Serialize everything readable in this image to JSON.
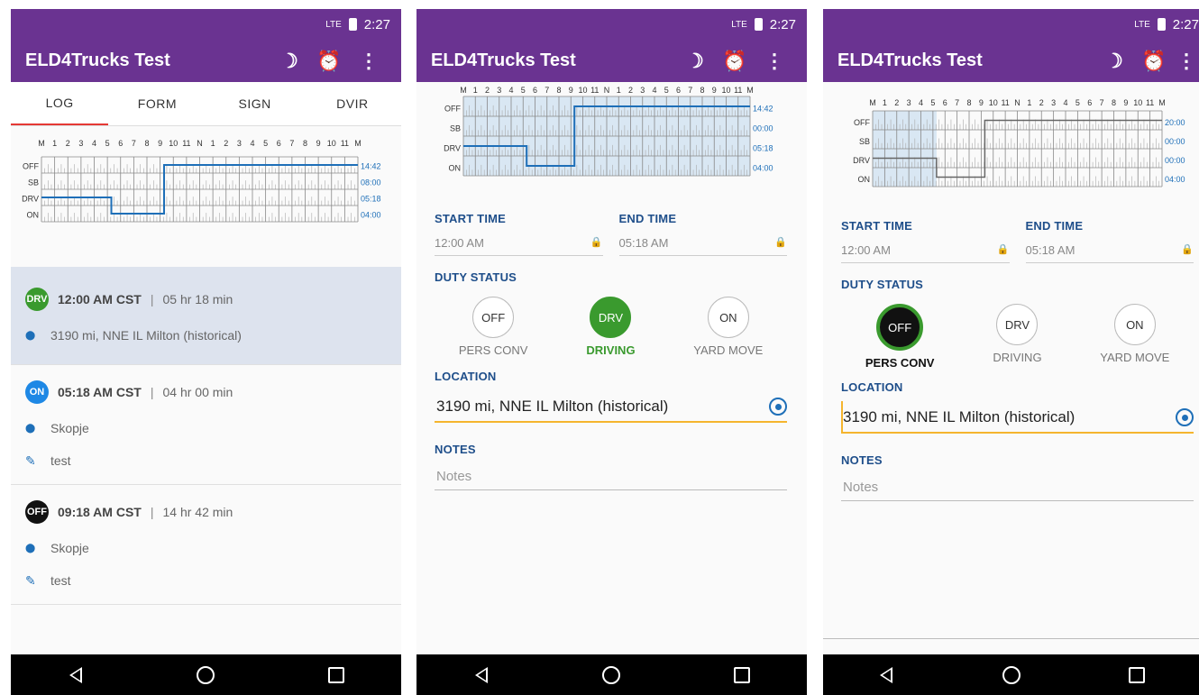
{
  "status_bar": {
    "network": "LTE",
    "time": "2:27"
  },
  "app": {
    "title": "ELD4Trucks Test",
    "icons": [
      "moon-icon",
      "alarm-icon",
      "more-vert-icon"
    ]
  },
  "tabs": [
    "LOG",
    "FORM",
    "SIGN",
    "DVIR"
  ],
  "chart": {
    "hour_labels": [
      "M",
      "1",
      "2",
      "3",
      "4",
      "5",
      "6",
      "7",
      "8",
      "9",
      "10",
      "11",
      "N",
      "1",
      "2",
      "3",
      "4",
      "5",
      "6",
      "7",
      "8",
      "9",
      "10",
      "11",
      "M"
    ],
    "row_labels": [
      "OFF",
      "SB",
      "DRV",
      "ON"
    ],
    "panel1_totals": [
      "14:42",
      "08:00",
      "05:18",
      "04:00"
    ],
    "panel2_totals": [
      "14:42",
      "00:00",
      "05:18",
      "04:00"
    ],
    "panel3_totals": [
      "20:00",
      "00:00",
      "00:00",
      "04:00"
    ]
  },
  "log_entries": [
    {
      "badge": "DRV",
      "badge_color": "#3a9a2e",
      "time": "12:00 AM CST",
      "duration": "05 hr 18 min",
      "location": "3190 mi, NNE IL Milton (historical)",
      "note": ""
    },
    {
      "badge": "ON",
      "badge_color": "#1e88e5",
      "time": "05:18 AM CST",
      "duration": "04 hr 00 min",
      "location": "Skopje",
      "note": "test"
    },
    {
      "badge": "OFF",
      "badge_color": "#111111",
      "time": "09:18 AM CST",
      "duration": "14 hr 42 min",
      "location": "Skopje",
      "note": "test"
    }
  ],
  "form": {
    "start_time_label": "START TIME",
    "end_time_label": "END TIME",
    "start_time": "12:00 AM",
    "end_time": "05:18 AM",
    "duty_status_label": "DUTY STATUS",
    "duty_options": [
      {
        "code": "OFF",
        "label": "PERS CONV"
      },
      {
        "code": "DRV",
        "label": "DRIVING"
      },
      {
        "code": "ON",
        "label": "YARD MOVE"
      }
    ],
    "location_label": "LOCATION",
    "location": "3190 mi, NNE IL Milton (historical)",
    "notes_label": "NOTES",
    "notes_placeholder": "Notes"
  },
  "colors": {
    "primary": "#6a3391",
    "green": "#3a9a2e",
    "blue": "#1e6fb8",
    "accent_underline": "#f5b52e"
  }
}
